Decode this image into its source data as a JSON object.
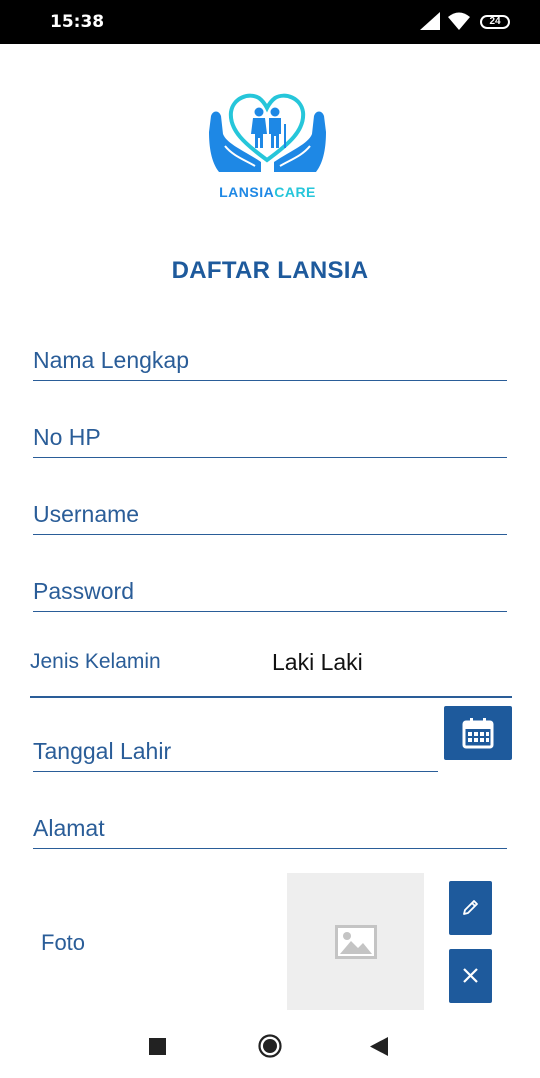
{
  "status_bar": {
    "time": "15:38",
    "battery_level": "24"
  },
  "logo": {
    "text_part1": "LANSIA",
    "text_part2": "CARE"
  },
  "page_title": "DAFTAR LANSIA",
  "form": {
    "full_name_placeholder": "Nama Lengkap",
    "phone_placeholder": "No HP",
    "username_placeholder": "Username",
    "password_placeholder": "Password",
    "gender_label": "Jenis Kelamin",
    "gender_value": "Laki Laki",
    "birth_date_placeholder": "Tanggal Lahir",
    "address_placeholder": "Alamat",
    "photo_label": "Foto"
  },
  "colors": {
    "primary": "#1e5a9c",
    "field_text": "#2a5d98",
    "logo_blue": "#1e88e5",
    "logo_teal": "#26c6da",
    "photo_placeholder_bg": "#eeeeee"
  },
  "icons": {
    "calendar": "calendar-icon",
    "edit": "pencil-icon",
    "remove": "close-icon",
    "photo_placeholder": "image-icon",
    "nav_recents": "square-icon",
    "nav_home": "circle-icon",
    "nav_back": "triangle-back-icon"
  }
}
